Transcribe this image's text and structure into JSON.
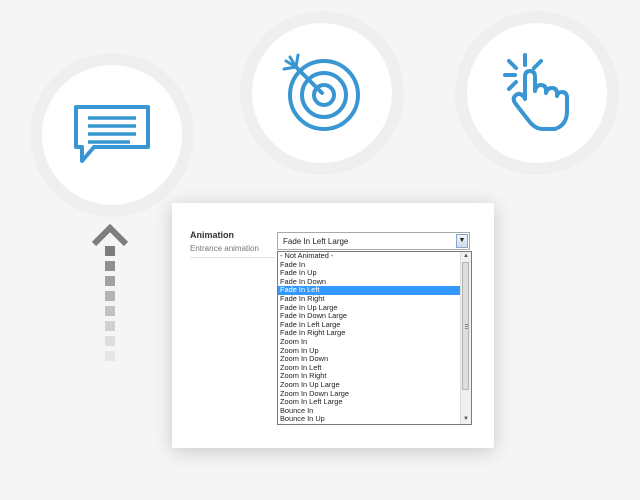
{
  "icons": {
    "chat": "chat-bubble-icon",
    "target": "target-icon",
    "click": "pointer-click-icon",
    "arrow": "dotted-up-arrow-icon",
    "accent_color": "#3a96d3",
    "arrow_color": "#7d7d7d"
  },
  "panel": {
    "title": "Animation",
    "subtitle": "Entrance animation",
    "selected_value": "Fade In Left Large",
    "dropdown_arrow": "▼"
  },
  "list": {
    "highlighted": "Fade In Left",
    "options": [
      "- Not Animated -",
      "Fade In",
      "Fade In Up",
      "Fade In Down",
      "Fade In Left",
      "Fade In Right",
      "Fade In Up Large",
      "Fade In Down Large",
      "Fade In Left Large",
      "Fade In Right Large",
      "Zoom In",
      "Zoom In Up",
      "Zoom In Down",
      "Zoom In Left",
      "Zoom In Right",
      "Zoom In Up Large",
      "Zoom In Down Large",
      "Zoom In Left Large",
      "Bounce In",
      "Bounce In Up"
    ],
    "scroll_up": "▲",
    "scroll_down": "▼"
  }
}
